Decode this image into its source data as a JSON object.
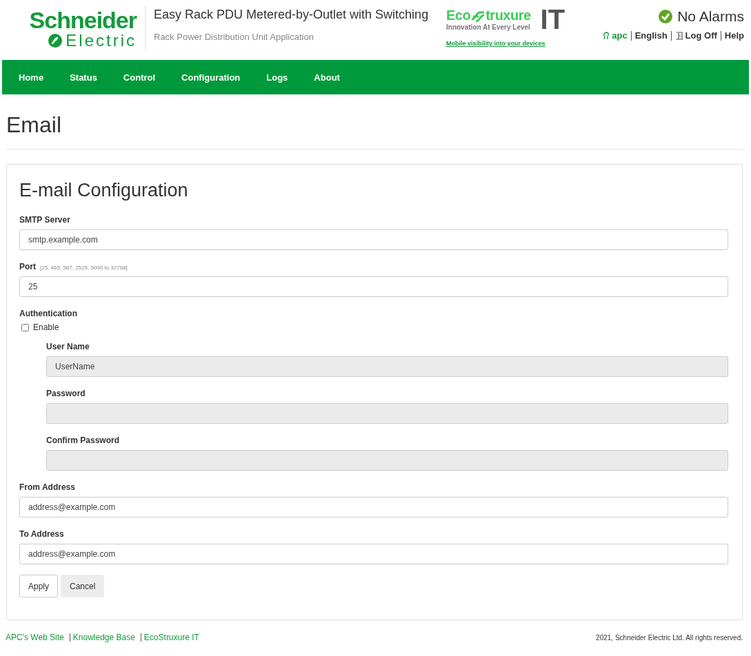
{
  "header": {
    "brand": {
      "line1": "Schneider",
      "line2": "Electric"
    },
    "title": "Easy Rack PDU Metered-by-Outlet with Switching",
    "subtitle": "Rack Power Distribution Unit Application",
    "eco": {
      "left": "Eco",
      "right": "truxure",
      "tagline": "Innovation At Every Level",
      "suffix": "IT",
      "link": "Mobile visibility into your devices"
    },
    "status": "No Alarms",
    "links": [
      {
        "kind": "user",
        "label": "apc"
      },
      {
        "kind": "plain",
        "label": "English"
      },
      {
        "kind": "logoff",
        "label": "Log Off"
      },
      {
        "kind": "plain",
        "label": "Help"
      }
    ]
  },
  "nav": [
    {
      "label": "Home"
    },
    {
      "label": "Status"
    },
    {
      "label": "Control"
    },
    {
      "label": "Configuration"
    },
    {
      "label": "Logs"
    },
    {
      "label": "About"
    }
  ],
  "page_title": "Email",
  "panel": {
    "title": "E-mail Configuration",
    "items": [
      {
        "kind": "field",
        "label": "SMTP Server",
        "value": "smtp.example.com",
        "disabled": false
      },
      {
        "kind": "field",
        "label": "Port",
        "hint": "[25, 465, 587, 2525, 5000 to 32768]",
        "value": "25",
        "disabled": false
      },
      {
        "kind": "group",
        "label": "Authentication",
        "checkbox": {
          "label": "Enable",
          "checked": false
        },
        "children": [
          {
            "kind": "field",
            "label": "User Name",
            "value": "UserName",
            "disabled": true
          },
          {
            "kind": "field",
            "label": "Password",
            "disabled": true
          },
          {
            "kind": "field",
            "label": "Confirm Password",
            "disabled": true
          }
        ]
      },
      {
        "kind": "field",
        "label": "From Address",
        "value": "address@example.com",
        "disabled": false
      },
      {
        "kind": "field",
        "label": "To Address",
        "value": "address@example.com",
        "disabled": false
      }
    ],
    "buttons": [
      {
        "kind": "primary",
        "label": "Apply"
      },
      {
        "kind": "secondary",
        "label": "Cancel"
      }
    ]
  },
  "footer": {
    "links": [
      "APC's Web Site",
      "Knowledge Base",
      "EcoStruxure IT"
    ],
    "copyright": "2021, Schneider Electric Ltd. All rights reserved."
  }
}
